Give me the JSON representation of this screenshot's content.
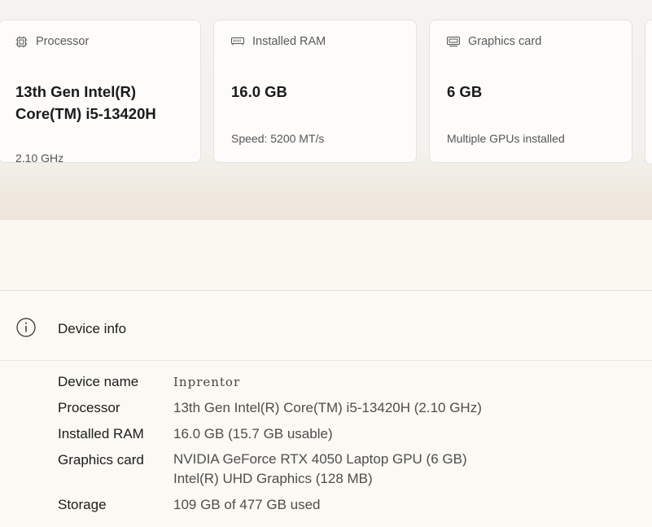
{
  "cards": {
    "processor": {
      "label": "Processor",
      "icon": "chip-icon",
      "value": "13th Gen Intel(R) Core(TM) i5-13420H",
      "sub": "2.10 GHz"
    },
    "ram": {
      "label": "Installed RAM",
      "icon": "memory-icon",
      "value": "16.0 GB",
      "sub": "Speed: 5200 MT/s"
    },
    "gpu": {
      "label": "Graphics card",
      "icon": "graphics-card-icon",
      "value": "6 GB",
      "sub": "Multiple GPUs installed"
    }
  },
  "device_info": {
    "title": "Device info",
    "icon": "info-icon",
    "rows": [
      {
        "label": "Device name",
        "value": "Inprentor"
      },
      {
        "label": "Processor",
        "value": "13th Gen Intel(R) Core(TM) i5-13420H (2.10 GHz)"
      },
      {
        "label": "Installed RAM",
        "value": "16.0 GB (15.7 GB usable)"
      },
      {
        "label": "Graphics card",
        "value": "NVIDIA GeForce RTX 4050 Laptop GPU (6 GB)",
        "value2": "Intel(R) UHD Graphics (128 MB)"
      },
      {
        "label": "Storage",
        "value": "109 GB of 477 GB used"
      }
    ]
  }
}
